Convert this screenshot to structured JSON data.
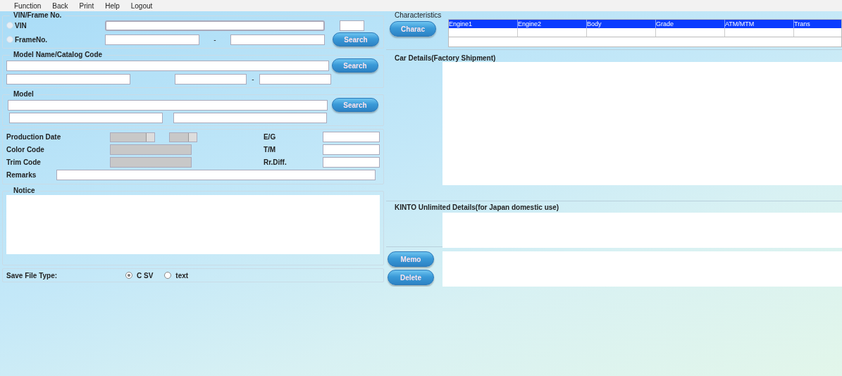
{
  "menu": [
    "Function",
    "Back",
    "Print",
    "Help",
    "Logout"
  ],
  "vin_section": {
    "title": "VIN/Frame No.",
    "options": [
      {
        "label": "VIN",
        "selected": false
      },
      {
        "label": "FrameNo.",
        "selected": false
      }
    ],
    "separator": "-",
    "search": "Search"
  },
  "model_name_section": {
    "title": "Model Name/Catalog Code",
    "separator": "-",
    "search": "Search"
  },
  "model_section": {
    "title": "Model",
    "search": "Search"
  },
  "details": {
    "left": [
      {
        "label": "Production Date",
        "kind": "date",
        "disabled": true
      },
      {
        "label": "Color Code",
        "kind": "text",
        "disabled": true
      },
      {
        "label": "Trim Code",
        "kind": "text",
        "disabled": true
      }
    ],
    "right": [
      {
        "label": "E/G"
      },
      {
        "label": "T/M"
      },
      {
        "label": "Rr.Diff."
      }
    ],
    "remarks": "Remarks"
  },
  "notice": {
    "title": "Notice"
  },
  "save_file_type": {
    "label": "Save File Type:",
    "options": [
      {
        "label": "C SV",
        "selected": true
      },
      {
        "label": "text",
        "selected": false
      }
    ]
  },
  "characteristics": {
    "title": "Characteristics",
    "button": "Charac",
    "columns": [
      "Engine1",
      "Engine2",
      "Body",
      "Grade",
      "ATM/MTM",
      "Trans"
    ]
  },
  "car_details": {
    "title": "Car Details(Factory Shipment)"
  },
  "kinto": {
    "title": "KINTO Unlimited Details(for Japan domestic use)"
  },
  "buttons": [
    "Memo",
    "Delete"
  ]
}
